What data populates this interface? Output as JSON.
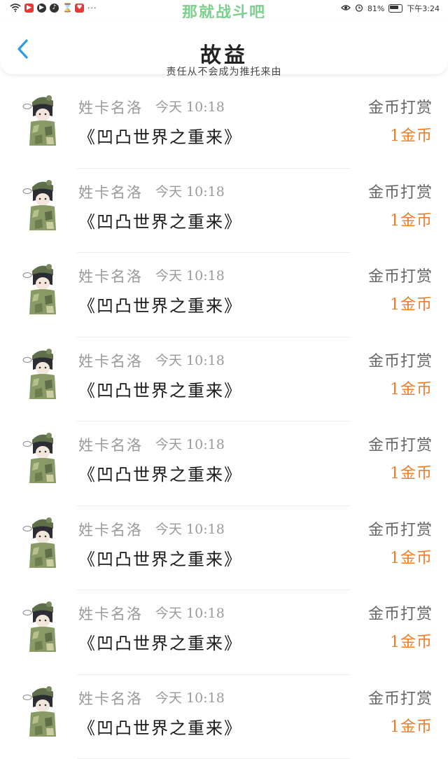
{
  "status_bar": {
    "title": "那就战斗吧",
    "battery_text": "81%",
    "time": "下午3:24",
    "icons": [
      "wifi-icon",
      "video-app-icon",
      "play-app-icon",
      "music-app-icon",
      "hourglass-icon",
      "notification-app-icon",
      "more-dots-icon"
    ]
  },
  "header": {
    "title": "故益",
    "subtitle": "责任从不会成为推托来由",
    "back_icon": "chevron-left-icon"
  },
  "colors": {
    "accent_blue": "#2f9be8",
    "amount_orange": "#ef7d2b",
    "status_green": "#7ccf8d"
  },
  "items": [
    {
      "user": "姓卡名洛",
      "time": "今天 10:18",
      "book": "《凹凸世界之重来》",
      "action": "金币打赏",
      "amount": "1金币"
    },
    {
      "user": "姓卡名洛",
      "time": "今天 10:18",
      "book": "《凹凸世界之重来》",
      "action": "金币打赏",
      "amount": "1金币"
    },
    {
      "user": "姓卡名洛",
      "time": "今天 10:18",
      "book": "《凹凸世界之重来》",
      "action": "金币打赏",
      "amount": "1金币"
    },
    {
      "user": "姓卡名洛",
      "time": "今天 10:18",
      "book": "《凹凸世界之重来》",
      "action": "金币打赏",
      "amount": "1金币"
    },
    {
      "user": "姓卡名洛",
      "time": "今天 10:18",
      "book": "《凹凸世界之重来》",
      "action": "金币打赏",
      "amount": "1金币"
    },
    {
      "user": "姓卡名洛",
      "time": "今天 10:18",
      "book": "《凹凸世界之重来》",
      "action": "金币打赏",
      "amount": "1金币"
    },
    {
      "user": "姓卡名洛",
      "time": "今天 10:18",
      "book": "《凹凸世界之重来》",
      "action": "金币打赏",
      "amount": "1金币"
    },
    {
      "user": "姓卡名洛",
      "time": "今天 10:18",
      "book": "《凹凸世界之重来》",
      "action": "金币打赏",
      "amount": "1金币"
    }
  ]
}
